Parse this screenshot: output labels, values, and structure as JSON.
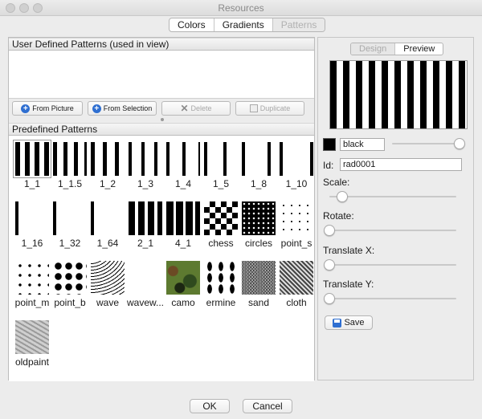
{
  "window": {
    "title": "Resources"
  },
  "top_tabs": {
    "colors": "Colors",
    "gradients": "Gradients",
    "patterns": "Patterns"
  },
  "user_section": {
    "title": "User Defined Patterns (used in view)",
    "buttons": {
      "from_picture": "From Picture",
      "from_selection": "From Selection",
      "delete": "Delete",
      "duplicate": "Duplicate"
    }
  },
  "predefined": {
    "title": "Predefined Patterns",
    "items": [
      "1_1",
      "1_1.5",
      "1_2",
      "1_3",
      "1_4",
      "1_5",
      "1_8",
      "1_10",
      "1_16",
      "1_32",
      "1_64",
      "2_1",
      "4_1",
      "chess",
      "circles",
      "point_s",
      "point_m",
      "point_b",
      "wave",
      "wavew...",
      "camo",
      "ermine",
      "sand",
      "cloth",
      "oldpaint"
    ],
    "selected": "1_1"
  },
  "right": {
    "tabs": {
      "design": "Design",
      "preview": "Preview"
    },
    "color_name": "black",
    "color_hex": "#000000",
    "id_label": "Id:",
    "id_value": "rad0001",
    "scale_label": "Scale:",
    "rotate_label": "Rotate:",
    "translate_x_label": "Translate X:",
    "translate_y_label": "Translate Y:",
    "save": "Save",
    "color_slider_value": 1.0,
    "scale_value": 0.1,
    "rotate_value": 0.0,
    "translate_x_value": 0.0,
    "translate_y_value": 0.0
  },
  "footer": {
    "ok": "OK",
    "cancel": "Cancel"
  },
  "accent_color": "#2f6fd1"
}
